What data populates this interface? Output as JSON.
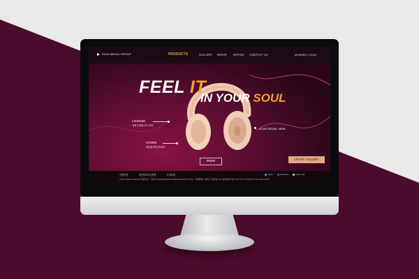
{
  "page": {
    "background": "#e9e9ea",
    "accent": "#4a0b2c"
  },
  "site": {
    "logo_text": "SOULMEDIA GROUP",
    "nav": [
      {
        "label": "PRODUCTS",
        "active": true
      },
      {
        "label": "GALLERY"
      },
      {
        "label": "MOVIE"
      },
      {
        "label": "NOTICE"
      },
      {
        "label": "CONTACT US"
      }
    ],
    "member_login": "MEMBER LOGIN",
    "headline": {
      "feel": "FEEL",
      "it": "IT",
      "in_your": "IN YOUR",
      "soul": "SOUL"
    },
    "callouts": [
      {
        "title": "LICENSE",
        "subtitle": "제품인증을 받으세요"
      },
      {
        "title": "STORE",
        "subtitle": "매장을 확인하세요"
      }
    ],
    "detail_label": "SL100 DETAIL VIEW",
    "more_button": "more",
    "artist_button": "ARTIST GALLERY",
    "footer": {
      "links": [
        "이용약관",
        "개인정보보호정책",
        "사이트맵"
      ],
      "info": "SOUL*MEDIA GROUP 대표이사 : 김효석  MASTER@SOULMEDIAGROUP.COM : 서울특별시 송파구 중앙동 38-5 중앙빌딩 5층   TEL 02)717-2183   FAX 02-3403-3466",
      "social": [
        "twitter",
        "facebook",
        "kakao talk"
      ]
    },
    "colors": {
      "orange": "#f2a02f",
      "button": "#e4a884",
      "screen_dark": "#2a0718"
    }
  }
}
